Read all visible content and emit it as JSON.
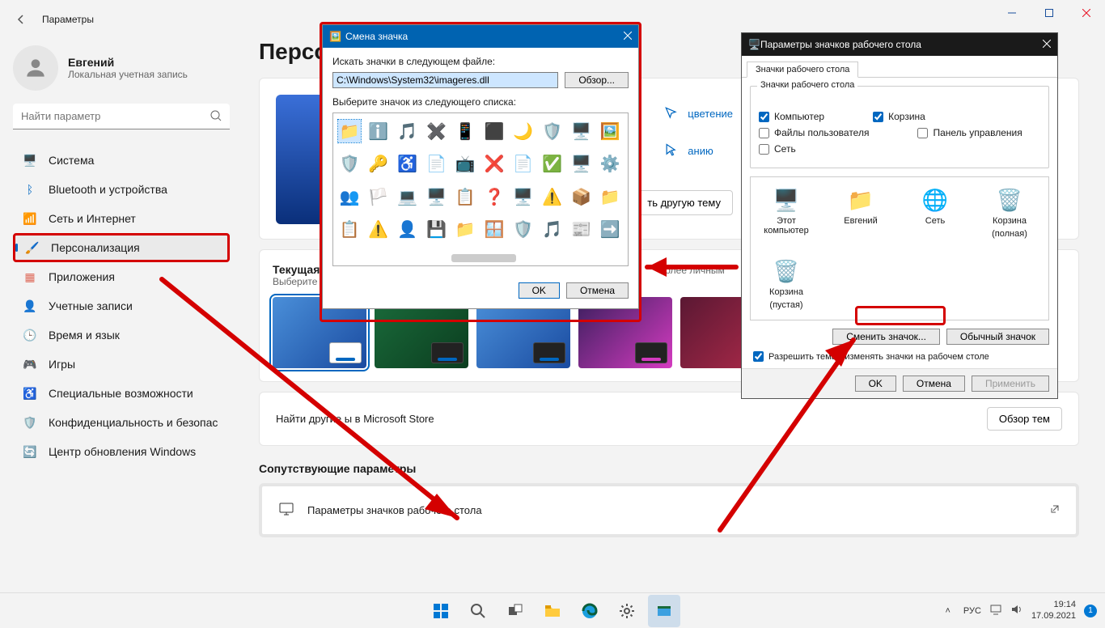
{
  "header": {
    "title": "Параметры"
  },
  "user": {
    "name": "Евгений",
    "sub": "Локальная учетная запись"
  },
  "search": {
    "placeholder": "Найти параметр"
  },
  "nav": [
    {
      "label": "Система",
      "icon": "display",
      "color": "#0067c0"
    },
    {
      "label": "Bluetooth и устройства",
      "icon": "bluetooth",
      "color": "#0067c0"
    },
    {
      "label": "Сеть и Интернет",
      "icon": "wifi",
      "color": "#00a2ed"
    },
    {
      "label": "Персонализация",
      "icon": "brush",
      "color": "#e29500",
      "active": true
    },
    {
      "label": "Приложения",
      "icon": "apps",
      "color": "#de6a5a"
    },
    {
      "label": "Учетные записи",
      "icon": "person",
      "color": "#b37b58"
    },
    {
      "label": "Время и язык",
      "icon": "clock",
      "color": "#c64e8a"
    },
    {
      "label": "Игры",
      "icon": "game",
      "color": "#777"
    },
    {
      "label": "Специальные возможности",
      "icon": "access",
      "color": "#5b8fd0"
    },
    {
      "label": "Конфиденциальность и безопас",
      "icon": "shield",
      "color": "#888"
    },
    {
      "label": "Центр обновления Windows",
      "icon": "update",
      "color": "#f28a1e"
    }
  ],
  "page": {
    "title": "Персо"
  },
  "quick": {
    "col": "цветение",
    "anim": "анию",
    "apply": "ть другую тему"
  },
  "current": {
    "title": "Текущая",
    "sub": "Выберите",
    "tail": " более личным"
  },
  "store": {
    "text": "Найти другие          ы в Microsoft Store",
    "btn": "Обзор тем"
  },
  "related": {
    "title": "Сопутствующие параметры",
    "item": "Параметры значков рабочего стола"
  },
  "change_dlg": {
    "title": "Смена значка",
    "path_label": "Искать значки в следующем файле:",
    "path": "C:\\Windows\\System32\\imageres.dll",
    "browse": "Обзор...",
    "pick": "Выберите значок из следующего списка:",
    "ok": "OK",
    "cancel": "Отмена"
  },
  "desk_dlg": {
    "title": "Параметры значков рабочего стола",
    "tab": "Значки рабочего стола",
    "group": "Значки рабочего стола",
    "chk_computer": "Компьютер",
    "chk_recycle": "Корзина",
    "chk_userfiles": "Файлы пользователя",
    "chk_cpanel": "Панель управления",
    "chk_network": "Сеть",
    "preview": [
      {
        "label": "Этот компьютер",
        "sub": ""
      },
      {
        "label": "Евгений",
        "sub": ""
      },
      {
        "label": "Сеть",
        "sub": ""
      },
      {
        "label": "Корзина",
        "sub": "(полная)"
      },
      {
        "label": "Корзина",
        "sub": "(пустая)"
      }
    ],
    "change": "Сменить значок...",
    "restore": "Обычный значок",
    "allow": "Разрешить темам изменять значки на рабочем столе",
    "ok": "OK",
    "cancel": "Отмена",
    "apply": "Применить"
  },
  "tray": {
    "lang": "РУС",
    "time": "19:14",
    "date": "17.09.2021"
  }
}
